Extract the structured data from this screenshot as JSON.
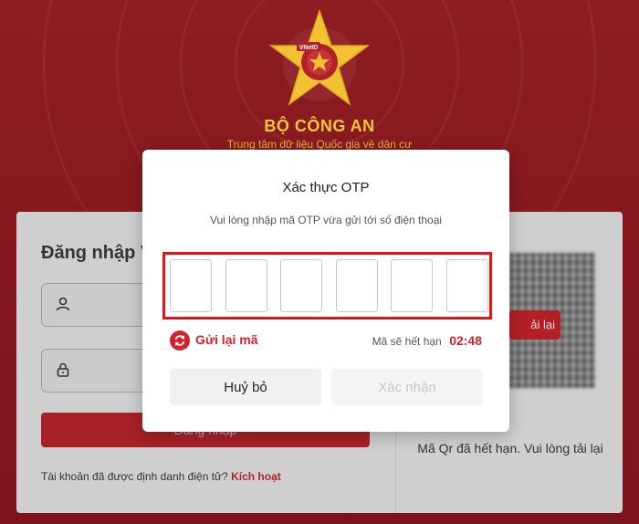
{
  "header": {
    "agency_name": "BỘ CÔNG AN",
    "agency_subtitle": "Trung tâm dữ liệu Quốc gia về dân cư",
    "logo_text": "VNeID"
  },
  "login": {
    "heading": "Đăng nhập V",
    "username_icon": "user-icon",
    "password_icon": "lock-icon",
    "submit_label": "Đăng nhập",
    "footer_text": "Tài khoản đã được định danh điện tử?",
    "activate_link": "Kích hoạt"
  },
  "qr": {
    "reload_label": "ải lại",
    "expired_message": "Mã Qr đã hết hạn. Vui lòng tải lại"
  },
  "otp_modal": {
    "title": "Xác thực OTP",
    "description": "Vui lòng nhập mã OTP vừa gửi tới số điện thoại",
    "digits": [
      "",
      "",
      "",
      "",
      "",
      ""
    ],
    "resend_label": "Gửi lại mã",
    "resend_icon": "refresh-icon",
    "expiry_label": "Mã sẽ hết hạn",
    "expiry_time": "02:48",
    "cancel_label": "Huỷ bỏ",
    "confirm_label": "Xác nhận"
  },
  "colors": {
    "brand_red": "#d2232c",
    "background": "#8a1a1f",
    "gold": "#f0c63a",
    "highlight": "#e0141d"
  }
}
